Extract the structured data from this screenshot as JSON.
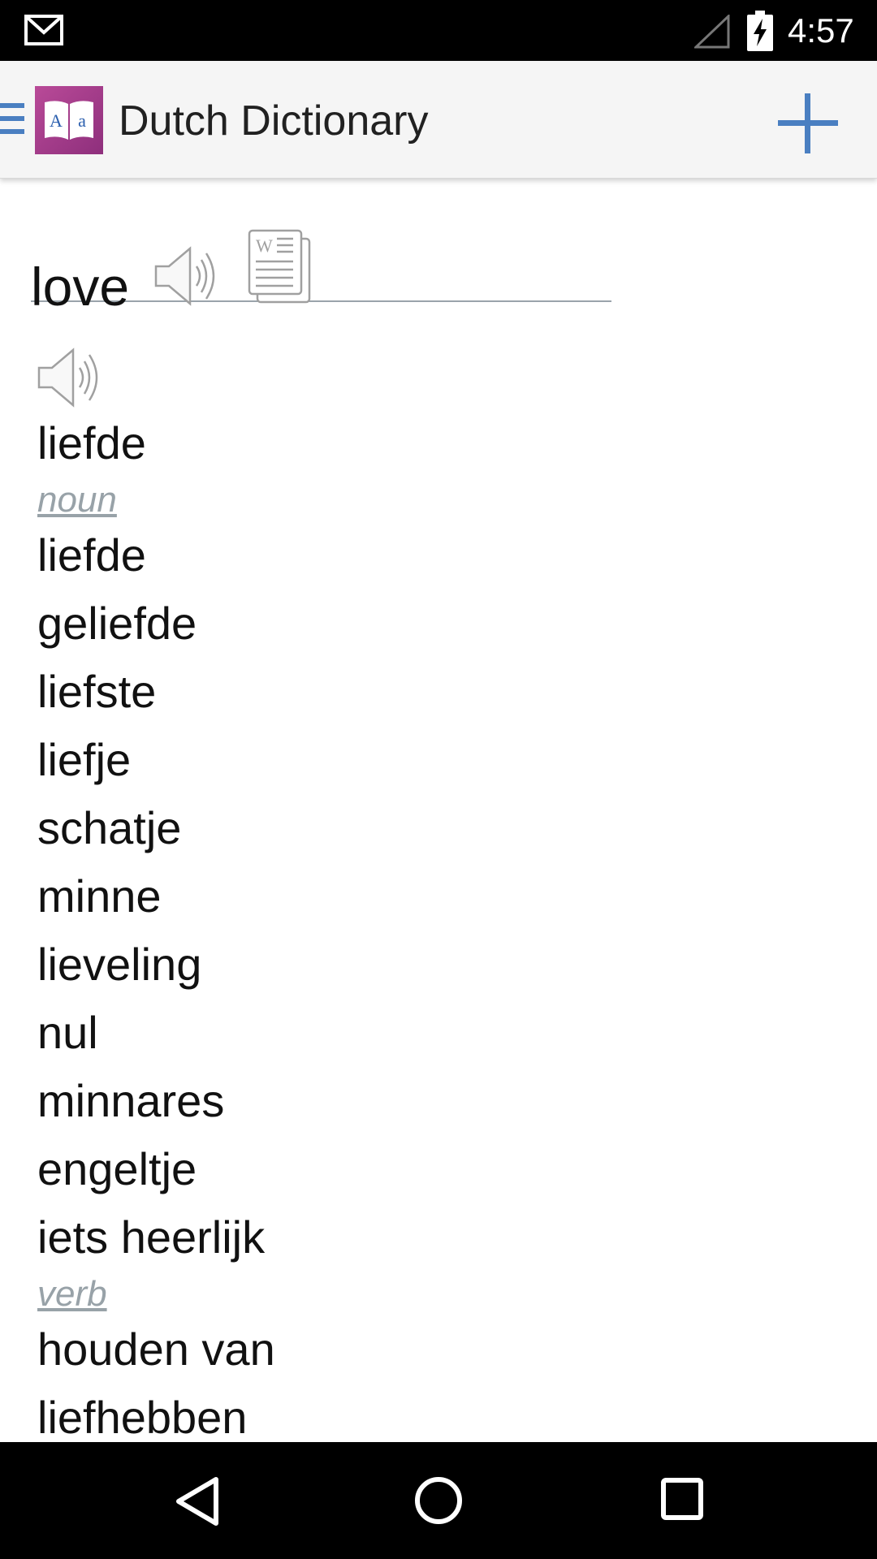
{
  "status_bar": {
    "time": "4:57",
    "icons": [
      "gmail-icon",
      "signal-icon",
      "battery-charging-icon"
    ]
  },
  "app_bar": {
    "title": "Dutch Dictionary",
    "logo_text": "A a",
    "menu_icon": "menu-icon",
    "add_icon": "plus-icon",
    "accent_color": "#4a7fc1",
    "logo_color": "#a43e8f"
  },
  "search": {
    "value": "love"
  },
  "translation": {
    "primary": "liefde",
    "sections": [
      {
        "part_of_speech": "noun",
        "words": [
          "liefde",
          "geliefde",
          "liefste",
          "liefje",
          "schatje",
          "minne",
          "lieveling",
          "nul",
          "minnares",
          "engeltje",
          "iets heerlijk"
        ]
      },
      {
        "part_of_speech": "verb",
        "words": [
          "houden van",
          "liefhebben"
        ]
      }
    ]
  },
  "nav_bar": {
    "icons": [
      "back-icon",
      "home-icon",
      "recents-icon"
    ]
  }
}
